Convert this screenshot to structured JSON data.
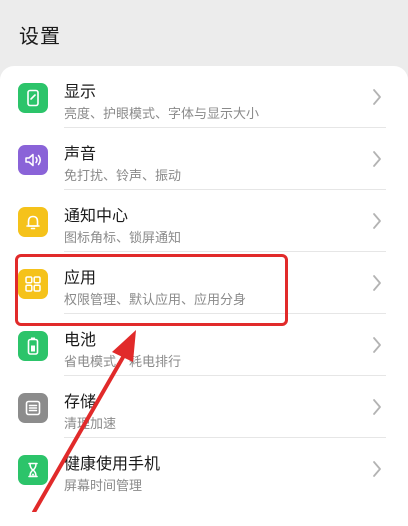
{
  "header": {
    "title": "设置"
  },
  "settings": {
    "items": [
      {
        "title": "显示",
        "subtitle": "亮度、护眼模式、字体与显示大小",
        "icon": "display-icon",
        "color": "#2cc46a"
      },
      {
        "title": "声音",
        "subtitle": "免打扰、铃声、振动",
        "icon": "sound-icon",
        "color": "#8a63d8"
      },
      {
        "title": "通知中心",
        "subtitle": "图标角标、锁屏通知",
        "icon": "bell-icon",
        "color": "#f5c21a"
      },
      {
        "title": "应用",
        "subtitle": "权限管理、默认应用、应用分身",
        "icon": "apps-grid-icon",
        "color": "#f5c21a"
      },
      {
        "title": "电池",
        "subtitle": "省电模式、耗电排行",
        "icon": "battery-icon",
        "color": "#2cc46a"
      },
      {
        "title": "存储",
        "subtitle": "清理加速",
        "icon": "storage-icon",
        "color": "#8c8c8c"
      },
      {
        "title": "健康使用手机",
        "subtitle": "屏幕时间管理",
        "icon": "hourglass-icon",
        "color": "#2cc46a"
      }
    ]
  },
  "annotation": {
    "highlight_color": "#e12a2a"
  }
}
